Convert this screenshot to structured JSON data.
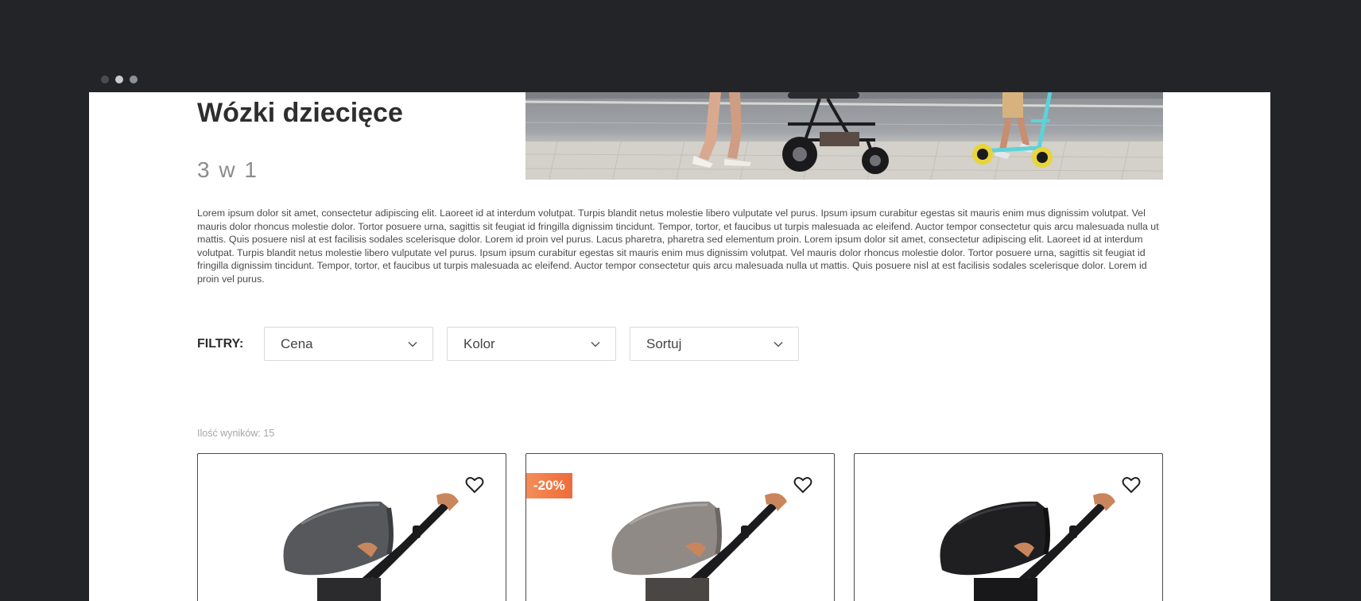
{
  "window": {
    "dots": [
      "dot",
      "dot",
      "dot"
    ]
  },
  "header": {
    "title": "Wózki dziecięce",
    "subtitle": "3 w 1"
  },
  "description": "Lorem ipsum dolor sit amet, consectetur adipiscing elit. Laoreet id at interdum volutpat. Turpis blandit netus molestie libero vulputate vel purus. Ipsum ipsum curabitur egestas sit mauris enim mus dignissim volutpat. Vel mauris dolor rhoncus molestie dolor. Tortor posuere urna, sagittis sit feugiat id fringilla dignissim tincidunt. Tempor, tortor, et faucibus ut turpis malesuada ac eleifend. Auctor tempor consectetur quis arcu malesuada nulla ut mattis. Quis posuere nisl at est facilisis sodales scelerisque dolor. Lorem id proin vel purus. Lacus pharetra, pharetra sed elementum proin. Lorem ipsum dolor sit amet, consectetur adipiscing elit. Laoreet id at interdum volutpat. Turpis blandit netus molestie libero vulputate vel purus. Ipsum ipsum curabitur egestas sit mauris enim mus dignissim volutpat. Vel mauris dolor rhoncus molestie dolor. Tortor posuere urna, sagittis sit feugiat id fringilla dignissim tincidunt. Tempor, tortor, et faucibus ut turpis malesuada ac eleifend. Auctor tempor consectetur quis arcu malesuada nulla ut mattis. Quis posuere nisl at est facilisis sodales scelerisque dolor. Lorem id proin vel purus.",
  "filters": {
    "label": "FILTRY:",
    "price": "Cena",
    "color": "Kolor",
    "sort": "Sortuj"
  },
  "results": {
    "count_label": "Ilość wyników: 15"
  },
  "products": [
    {
      "badge": "",
      "canopy_color": "#56585b"
    },
    {
      "badge": "-20%",
      "canopy_color": "#8f8a86"
    },
    {
      "badge": "",
      "canopy_color": "#1f1f21"
    }
  ],
  "colors": {
    "background": "#232428",
    "accent": "#ee6b3b",
    "text": "#2e2e2e"
  },
  "icons": {
    "filter_chevron": "chevron-down-icon",
    "favorite": "heart-icon"
  }
}
